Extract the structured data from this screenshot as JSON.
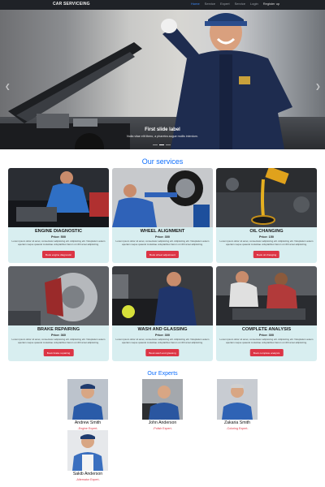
{
  "navbar": {
    "brand": "CAR SERVICEING",
    "links": [
      {
        "label": "Home",
        "state": "active"
      },
      {
        "label": "Service",
        "state": "normal"
      },
      {
        "label": "Expert",
        "state": "normal"
      },
      {
        "label": "Service",
        "state": "normal"
      },
      {
        "label": "Login",
        "state": "normal"
      },
      {
        "label": "Register up",
        "state": "light"
      }
    ]
  },
  "hero": {
    "caption_title": "First slide label",
    "caption_text": "Nulla vitae elit libero, a pharetra augue mollis interdum.",
    "indicator_count": 3,
    "active_indicator": 1
  },
  "services": {
    "title": "Our services",
    "items": [
      {
        "name": "ENGINE DIAGNOSTIC",
        "price": "Price: 500",
        "desc": "Lorem ipsum dolor sit amet, consectetur adipisicing elit. Adipisicing elit. Voluptatum autem aperiam neque quaerat molestiae voluptatibus harum ut nihil amet adipisicing.",
        "button": "Book engine diagnostic"
      },
      {
        "name": "WHEEL ALIGNMENT",
        "price": "Price: 300",
        "desc": "Lorem ipsum dolor sit amet, consectetur adipisicing elit. Adipisicing elit. Voluptatum autem aperiam neque quaerat molestiae voluptatibus harum ut nihil amet adipisicing.",
        "button": "Book wheel adjustment"
      },
      {
        "name": "OIL CHANGING",
        "price": "Price: 150",
        "desc": "Lorem ipsum dolor sit amet, consectetur adipisicing elit. Adipisicing elit. Voluptatum autem aperiam neque quaerat molestiae voluptatibus harum ut nihil amet adipisicing.",
        "button": "Book oil changing"
      },
      {
        "name": "BRAKE REPAIRING",
        "price": "Price: 360",
        "desc": "Lorem ipsum dolor sit amet, consectetur adipisicing elit. Adipisicing elit. Voluptatum autem aperiam neque quaerat molestiae voluptatibus harum ut nihil amet adipisicing.",
        "button": "Book brake repairing"
      },
      {
        "name": "WASH AND GLASSING",
        "price": "Price: 300",
        "desc": "Lorem ipsum dolor sit amet, consectetur adipisicing elit. Adipisicing elit. Voluptatum autem aperiam neque quaerat molestiae voluptatibus harum ut nihil amet adipisicing.",
        "button": "Book wash and glassing"
      },
      {
        "name": "COMPLETE ANALYSIS",
        "price": "Price: 300",
        "desc": "Lorem ipsum dolor sit amet, consectetur adipisicing elit. Adipisicing elit. Voluptatum autem aperiam neque quaerat molestiae voluptatibus harum ut nihil amet adipisicing.",
        "button": "Book complete analysis"
      }
    ]
  },
  "experts": {
    "title": "Our Experts",
    "items": [
      {
        "name": "Andrew Smith",
        "role": "-Engine Expert-"
      },
      {
        "name": "John Anderson",
        "role": "-Polish Expert-"
      },
      {
        "name": "Zakaria Smith",
        "role": "-Coloring Expert-"
      },
      {
        "name": "Sakib Anderson",
        "role": "-Alternator Expert-"
      }
    ]
  },
  "colors": {
    "navbar_bg": "#1f2227",
    "accent_blue": "#0d6efd",
    "card_bg": "#d8eef0",
    "button_red": "#dc3545",
    "role_red": "#dc3545"
  }
}
